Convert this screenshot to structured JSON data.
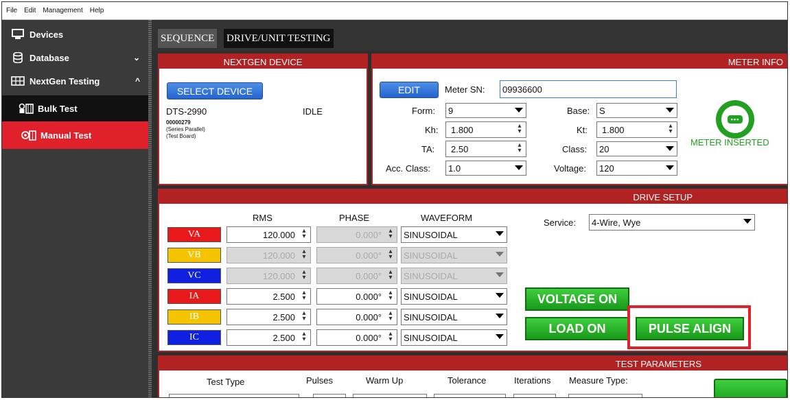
{
  "menu": [
    "File",
    "Edit",
    "Management",
    "Help"
  ],
  "sidebar": {
    "items": [
      {
        "label": "Devices",
        "icon": "monitor-icon"
      },
      {
        "label": "Database",
        "icon": "database-icon",
        "chevron": "⌄"
      },
      {
        "label": "NextGen Testing",
        "icon": "testing-icon",
        "chevron": "^"
      },
      {
        "label": "Bulk Test",
        "icon": "bulk-test-icon"
      },
      {
        "label": "Manual Test",
        "icon": "manual-test-icon"
      }
    ]
  },
  "tabs": [
    {
      "label": "SEQUENCE"
    },
    {
      "label": "DRIVE/UNIT TESTING"
    }
  ],
  "nextgen": {
    "title": "NEXTGEN DEVICE",
    "select_label": "SELECT DEVICE",
    "device_name": "DTS-2990",
    "status": "IDLE",
    "serial": "00000279",
    "line1": "(Series Parallel)",
    "line2": "(Test Board)"
  },
  "meter": {
    "title": "METER INFO",
    "edit_label": "EDIT",
    "sn_label": "Meter SN:",
    "sn_value": "09936600",
    "form_label": "Form:",
    "form_value": "9",
    "base_label": "Base:",
    "base_value": "S",
    "kh_label": "Kh:",
    "kh_value": "1.800",
    "kt_label": "Kt:",
    "kt_value": "1.800",
    "ta_label": "TA:",
    "ta_value": "2.50",
    "class_label": "Class:",
    "class_value": "20",
    "acc_label": "Acc. Class:",
    "acc_value": "1.0",
    "voltage_label": "Voltage:",
    "voltage_value": "120",
    "inserted_label": "METER INSERTED"
  },
  "drive": {
    "title": "DRIVE SETUP",
    "col_rms": "RMS",
    "col_phase": "PHASE",
    "col_waveform": "WAVEFORM",
    "service_label": "Service:",
    "service_value": "4-Wire, Wye",
    "rows": [
      {
        "label": "VA",
        "color": "#e8191a",
        "rms": "120.000",
        "phase": "0.000°",
        "waveform": "SINUSOIDAL"
      },
      {
        "label": "VB",
        "color": "#f5c400",
        "rms": "120.000",
        "phase": "0.000°",
        "waveform": "SINUSOIDAL"
      },
      {
        "label": "VC",
        "color": "#1020e0",
        "rms": "120.000",
        "phase": "0.000°",
        "waveform": "SINUSOIDAL"
      },
      {
        "label": "IA",
        "color": "#e8191a",
        "rms": "2.500",
        "phase": "0.000°",
        "waveform": "SINUSOIDAL"
      },
      {
        "label": "IB",
        "color": "#f5c400",
        "rms": "2.500",
        "phase": "0.000°",
        "waveform": "SINUSOIDAL"
      },
      {
        "label": "IC",
        "color": "#1020e0",
        "rms": "2.500",
        "phase": "0.000°",
        "waveform": "SINUSOIDAL"
      }
    ],
    "voltage_on": "VOLTAGE ON",
    "load_on": "LOAD ON",
    "pulse_align": "PULSE ALIGN"
  },
  "test": {
    "title": "TEST PARAMETERS",
    "cols": [
      "Test Type",
      "Pulses",
      "Warm Up",
      "Tolerance",
      "Iterations",
      "Measure Type:"
    ]
  },
  "colors": {
    "accent_red": "#b22222",
    "highlight_red": "#e0202a",
    "green": "#189918",
    "blue": "#2563d0"
  }
}
